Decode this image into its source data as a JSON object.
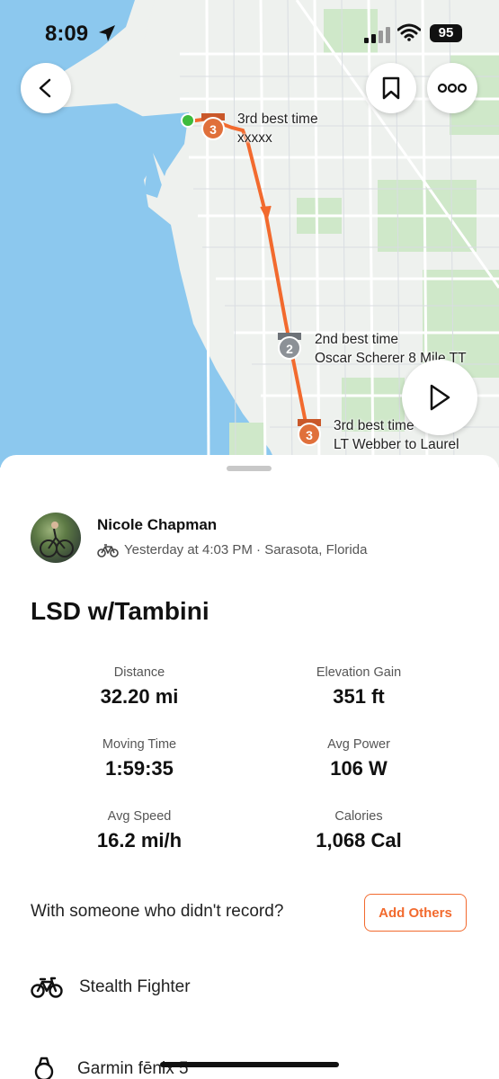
{
  "status_bar": {
    "time": "8:09",
    "battery": "95"
  },
  "map": {
    "segments": [
      {
        "rank_badge": "3",
        "line1": "3rd best time",
        "line2": "xxxxx"
      },
      {
        "rank_badge": "2",
        "line1": "2nd best time",
        "line2": "Oscar Scherer 8 Mile TT"
      },
      {
        "rank_badge": "3",
        "line1": "3rd best time",
        "line2": "LT Webber to Laurel"
      }
    ],
    "route_color": "#f26a2e",
    "start_color": "#3dbb3d"
  },
  "activity": {
    "athlete": "Nicole Chapman",
    "meta": "Yesterday at 4:03 PM · Sarasota, Florida",
    "title": "LSD w/Tambini",
    "stats": [
      {
        "label": "Distance",
        "value": "32.20 mi"
      },
      {
        "label": "Elevation Gain",
        "value": "351 ft"
      },
      {
        "label": "Moving Time",
        "value": "1:59:35"
      },
      {
        "label": "Avg Power",
        "value": "106 W"
      },
      {
        "label": "Avg Speed",
        "value": "16.2 mi/h"
      },
      {
        "label": "Calories",
        "value": "1,068 Cal"
      }
    ],
    "with_prompt": "With someone who didn't record?",
    "add_others_label": "Add Others",
    "bike": "Stealth Fighter",
    "device": "Garmin fēnix 5"
  },
  "colors": {
    "accent": "#f26a2e",
    "water": "#8cc8ee",
    "land": "#eef1ee",
    "park": "#cfe8c9"
  }
}
